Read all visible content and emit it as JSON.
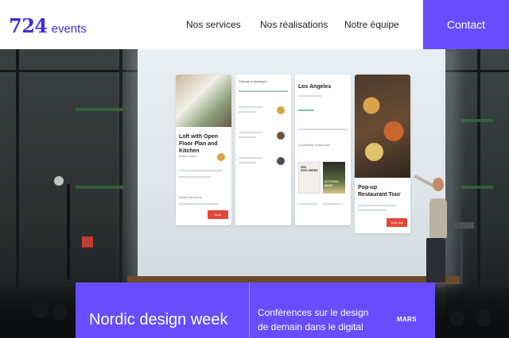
{
  "header": {
    "logo_number": "724",
    "logo_word": "events",
    "nav": [
      {
        "label": "Nos services"
      },
      {
        "label": "Nos réalisations"
      },
      {
        "label": "Notre équipe"
      }
    ],
    "contact_label": "Contact"
  },
  "hero": {
    "screen_cards": [
      {
        "title": "Loft with Open Floor Plan and Kitchen",
        "caption": "Entire home",
        "section": "About this home",
        "button": "Book"
      },
      {
        "header": "Choose a developer"
      },
      {
        "title": "Los Angeles",
        "section": "3 available restaurants",
        "thumb_a": "ZEN EXPLORERS",
        "thumb_b": "KITCHEN BEEF"
      },
      {
        "title": "Pop-up Restaurant Tour",
        "button": "Book now"
      }
    ]
  },
  "event": {
    "title": "Nordic design week",
    "description": "Conférences sur le design de demain dans le digital",
    "month": "MARS"
  },
  "colors": {
    "brand_purple": "#6a4cff",
    "logo_blue": "#3f2fd6"
  }
}
